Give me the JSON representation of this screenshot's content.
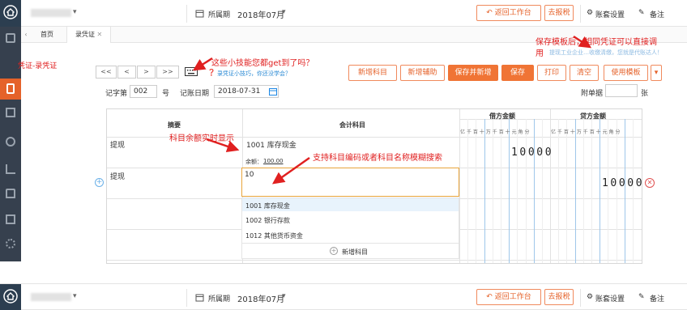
{
  "topbar": {
    "period_label": "所属期",
    "period_value": "2018年07月",
    "back_button": "返回工作台",
    "report_button": "去报税",
    "settings": "账套设置",
    "notes": "备注"
  },
  "tabs": [
    {
      "label": "首页"
    },
    {
      "label": "录凭证"
    }
  ],
  "breadcrumb": "凭证-录凭证",
  "nav": {
    "first": "<<",
    "prev": "<",
    "next": ">",
    "last": ">>"
  },
  "tips": {
    "keyboard_annotation": "这些小技能您都get到了吗？",
    "help_link": "录凭证小技巧，你还没学会？",
    "template_annotation": "保存模板后，相同凭证可以直接调用",
    "faint_text": "提现工业企业…收缴清缴，您就是代账达人！"
  },
  "toolbar": {
    "add_account": "新增科目",
    "add_aux": "新增辅助",
    "save_new": "保存并新增",
    "save": "保存",
    "print": "打印",
    "clear": "清空",
    "use_template": "使用模板"
  },
  "voucher": {
    "word_label": "记字第",
    "number": "002",
    "number_suffix": "号",
    "date_label": "记账日期",
    "date": "2018-07-31",
    "attach_label": "附单据",
    "attach_suffix": "张"
  },
  "table": {
    "headers": {
      "summary": "摘要",
      "account": "会计科目",
      "debit": "借方金额",
      "credit": "贷方金额"
    },
    "digit_labels": "亿千百十万千百十元角分",
    "rows": [
      {
        "summary": "提现",
        "account": "1001 库存现金",
        "balance_label": "余额：",
        "balance": "100.00",
        "debit": "10000",
        "credit": ""
      },
      {
        "summary": "提现",
        "account": "10",
        "debit": "",
        "credit": "10000"
      }
    ]
  },
  "annotations": {
    "balance": "科目余额实时显示",
    "search": "支持科目编码或者科目名称模糊搜索"
  },
  "dropdown": {
    "items": [
      {
        "label": "1001 库存现金"
      },
      {
        "label": "1002 银行存款"
      },
      {
        "label": "1012 其他货币资金"
      }
    ],
    "add_label": "新增科目"
  },
  "colors": {
    "accent": "#e5622a",
    "annotation": "#e02020",
    "sidebar": "#36404e"
  }
}
